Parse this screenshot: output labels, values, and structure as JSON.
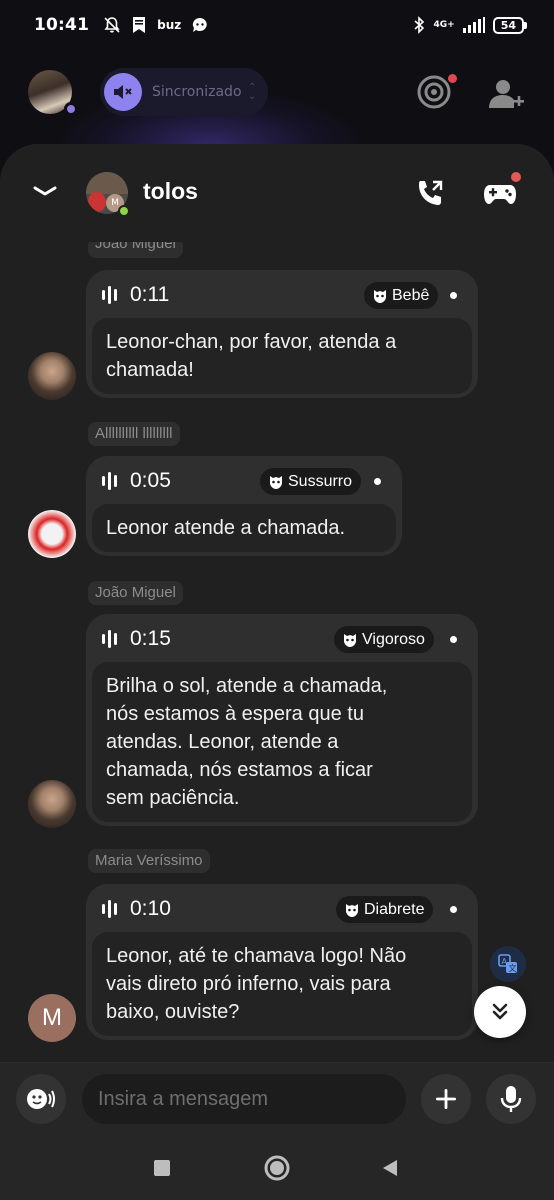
{
  "status_bar": {
    "time": "10:41",
    "network": "4G+",
    "battery": "54",
    "app_badge": "buz"
  },
  "top_bar": {
    "sync_text": "Sincronizado com \"Nã...",
    "radar_notification": true
  },
  "chat": {
    "title": "tolos",
    "online": true
  },
  "messages": [
    {
      "sender": "João Miguel",
      "duration": "0:11",
      "voice_filter": "Bebê",
      "transcript_lines": [
        "Leonor-chan, por favor, atenda a",
        "chamada!"
      ],
      "avatar": "boy"
    },
    {
      "sender": "Allllllllll lllllllll",
      "duration": "0:05",
      "voice_filter": "Sussurro",
      "transcript_lines": [
        "Leonor atende a chamada."
      ],
      "avatar": "clown"
    },
    {
      "sender": "João Miguel",
      "duration": "0:15",
      "voice_filter": "Vigoroso",
      "transcript_lines": [
        "Brilha o sol, atende a chamada,",
        "nós estamos à espera que tu",
        "atendas. Leonor, atende a",
        "chamada, nós estamos a ficar",
        "sem paciência."
      ],
      "avatar": "boy"
    },
    {
      "sender": "Maria Veríssimo",
      "duration": "0:10",
      "voice_filter": "Diabrete",
      "transcript_lines": [
        "Leonor, até te chamava logo! Não",
        "vais direto pró inferno, vais para",
        "baixo, ouviste?"
      ],
      "avatar": "M"
    }
  ],
  "input": {
    "placeholder": "Insira a mensagem"
  },
  "colors": {
    "accent": "#8e82ee",
    "notification": "#e0484f",
    "online": "#8ed54a",
    "bubble": "#2f2f2f",
    "transcript_bg": "#232323"
  },
  "icons": {
    "voice_filter": "mask-icon",
    "message_wave": "audio-wave-icon"
  }
}
